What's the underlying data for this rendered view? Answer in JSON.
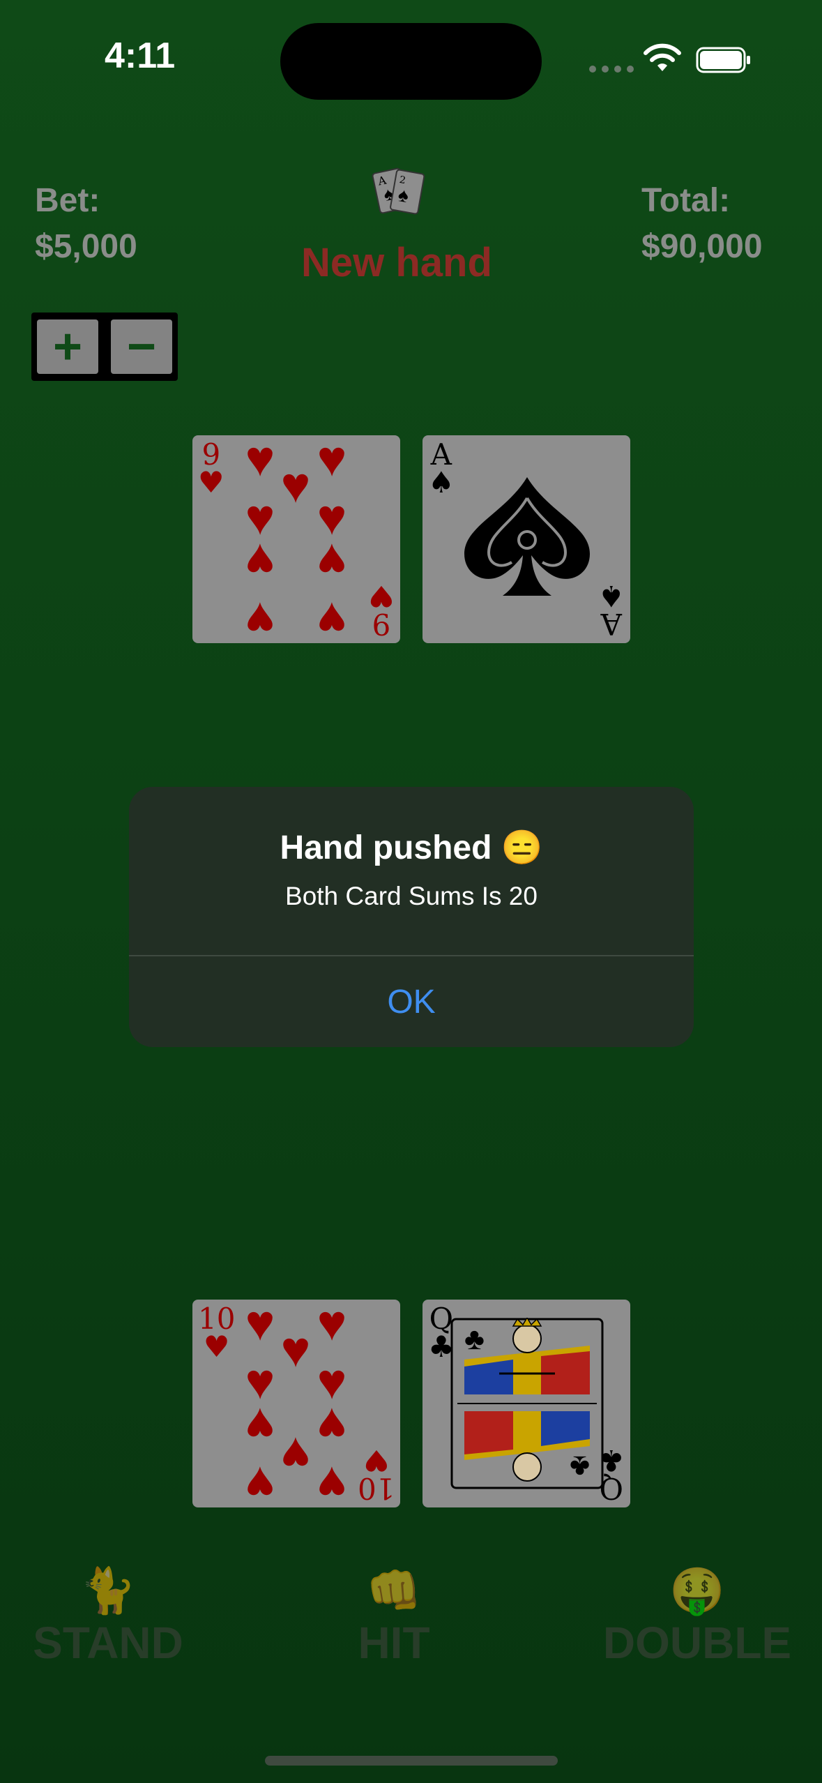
{
  "status_bar": {
    "time": "4:11"
  },
  "header": {
    "bet_label": "Bet:",
    "bet_value": "$5,000",
    "total_label": "Total:",
    "total_value": "$90,000",
    "status_text": "New hand"
  },
  "stepper": {
    "plus_label": "+",
    "minus_label": "−"
  },
  "dealer_cards": [
    {
      "rank": "9",
      "suit": "♥"
    },
    {
      "rank": "A",
      "suit": "♠"
    }
  ],
  "player_cards": [
    {
      "rank": "10",
      "suit": "♥"
    },
    {
      "rank": "Q",
      "suit": "♣"
    }
  ],
  "alert": {
    "title": "Hand pushed 😑",
    "message": "Both Card Sums Is 20",
    "ok_label": "OK"
  },
  "actions": [
    {
      "emoji": "🐈",
      "label": "STAND"
    },
    {
      "emoji": "👊",
      "label": "HIT"
    },
    {
      "emoji": "🤑",
      "label": "DOUBLE"
    }
  ],
  "colors": {
    "table_green": "#0c4114",
    "status_red": "#8c2a24",
    "card_red": "#9b0000",
    "alert_link": "#3f8ef0"
  }
}
